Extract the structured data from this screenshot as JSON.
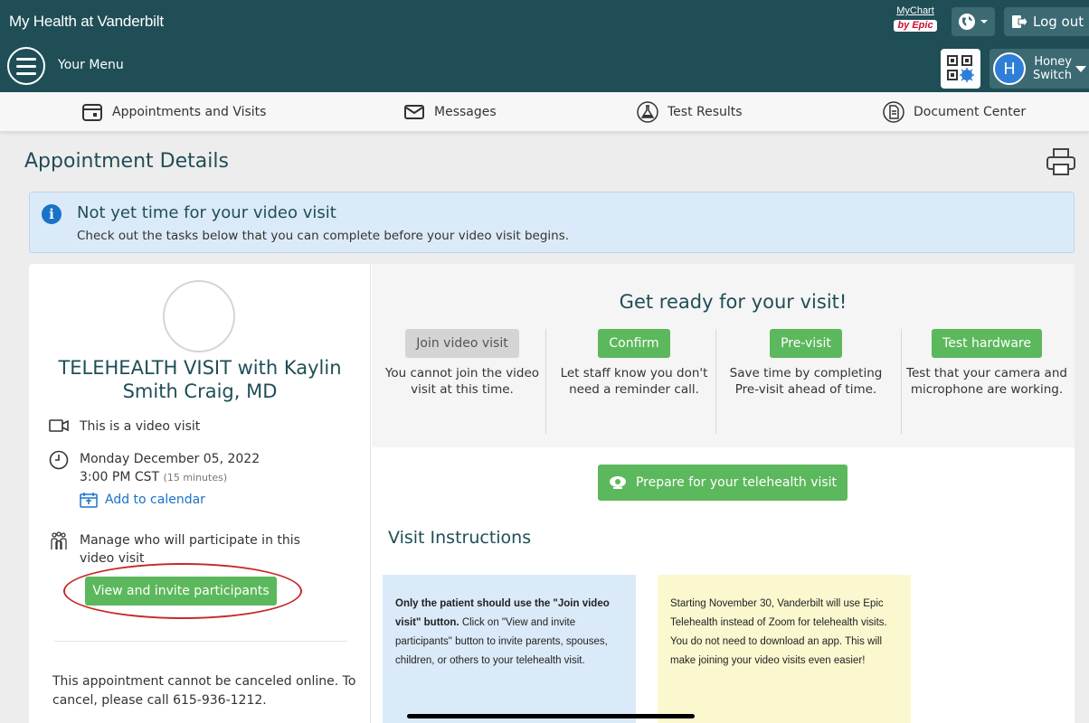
{
  "header": {
    "brand": "My Health at Vanderbilt",
    "mychart_logo": "MyChart",
    "mychart_by": "by Epic",
    "logout_label": "Log out",
    "menu_label": "Your Menu",
    "user": {
      "initial": "H",
      "first": "Honey",
      "last": "Switch"
    }
  },
  "nav": {
    "items": [
      {
        "label": "Appointments and Visits",
        "icon": "calendar-icon"
      },
      {
        "label": "Messages",
        "icon": "envelope-icon"
      },
      {
        "label": "Test Results",
        "icon": "flask-icon"
      },
      {
        "label": "Document Center",
        "icon": "document-icon"
      }
    ]
  },
  "page": {
    "title": "Appointment Details"
  },
  "alert": {
    "title": "Not yet time for your video visit",
    "text": "Check out the tasks below that you can complete before your video visit begins."
  },
  "visit": {
    "title": "TELEHEALTH VISIT with Kaylin Smith Craig, MD",
    "video_note": "This is a video visit",
    "date": "Monday December 05, 2022",
    "time": "3:00 PM CST",
    "duration": "(15 minutes)",
    "add_calendar": "Add to calendar",
    "manage_text": "Manage who will participate in this video visit",
    "invite_button": "View and invite participants",
    "cancel_text": "This appointment cannot be canceled online. To cancel, please call 615-936-1212."
  },
  "ready": {
    "title": "Get ready for your visit!",
    "steps": [
      {
        "button": "Join video visit",
        "text": "You cannot join the video visit at this time.",
        "enabled": false
      },
      {
        "button": "Confirm",
        "text": "Let staff know you don't need a reminder call.",
        "enabled": true
      },
      {
        "button": "Pre-visit",
        "text": "Save time by completing Pre-visit ahead of time.",
        "enabled": true
      },
      {
        "button": "Test hardware",
        "text": "Test that your camera and microphone are working.",
        "enabled": true
      }
    ],
    "prepare_button": "Prepare for your telehealth visit"
  },
  "instructions": {
    "title": "Visit Instructions",
    "blue_bold": "Only the patient should use the \"Join video visit\" button.",
    "blue_text": " Click on \"View and invite participants\" button to invite parents, spouses, children, or others to your telehealth visit.",
    "yellow_text": "Starting November 30, Vanderbilt will use Epic Telehealth instead of Zoom for telehealth visits. You do not need to download an app. This will make joining your video visits even easier!"
  },
  "colors": {
    "header_bg": "#1f4e57",
    "accent_green": "#5cb85c",
    "link_blue": "#1a73c8",
    "alert_bg": "#dbeaf8",
    "highlight_red": "#c62828"
  }
}
